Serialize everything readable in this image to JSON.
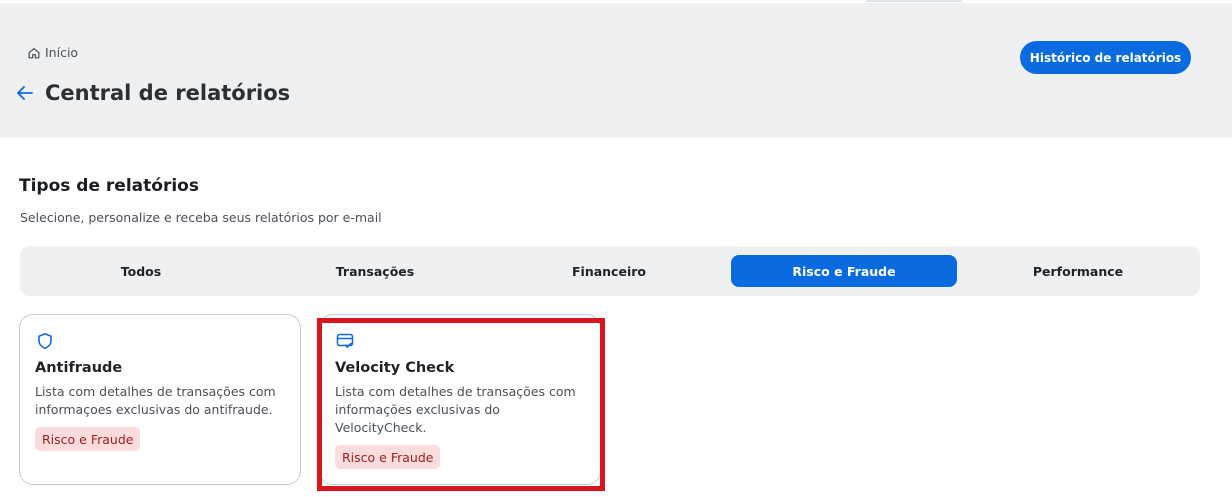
{
  "breadcrumb": {
    "home_label": "Início"
  },
  "header": {
    "title": "Central de relatórios",
    "history_button": "Histórico de relatórios"
  },
  "section": {
    "title": "Tipos de relatórios",
    "subtitle": "Selecione, personalize e receba seus relatórios por e-mail"
  },
  "tabs": [
    {
      "label": "Todos",
      "active": false
    },
    {
      "label": "Transações",
      "active": false
    },
    {
      "label": "Financeiro",
      "active": false
    },
    {
      "label": "Risco e Fraude",
      "active": true
    },
    {
      "label": "Performance",
      "active": false
    }
  ],
  "cards": [
    {
      "icon": "shield-icon",
      "title": "Antifraude",
      "description": "Lista com detalhes de transações com informaçoes exclusivas do antifraude.",
      "badge": "Risco e Fraude"
    },
    {
      "icon": "card-check-icon",
      "title": "Velocity Check",
      "description": "Lista com detalhes de transações com informações exclusivas do VelocityCheck.",
      "badge": "Risco e Fraude"
    }
  ],
  "colors": {
    "accent": "#0a6be0",
    "badge_bg": "#fbdcdc",
    "badge_text": "#9a1d1d",
    "highlight": "#d9161e"
  }
}
